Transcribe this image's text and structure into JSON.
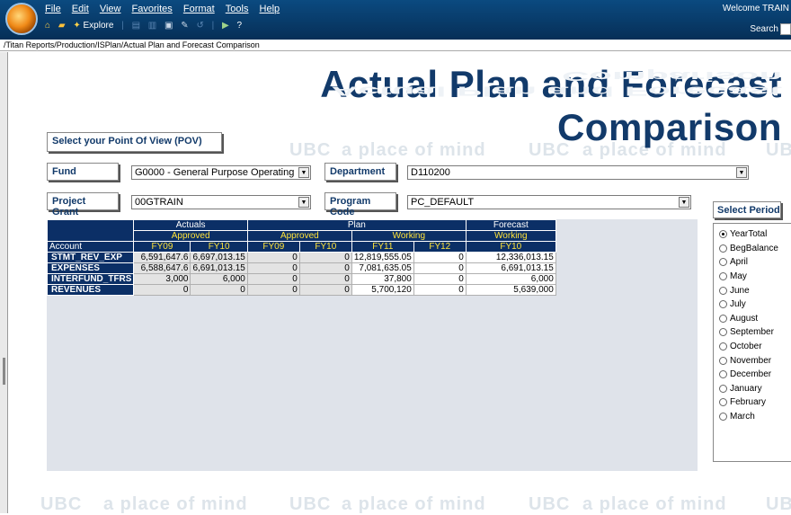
{
  "menu": [
    "File",
    "Edit",
    "View",
    "Favorites",
    "Format",
    "Tools",
    "Help"
  ],
  "toolbar": {
    "explore_label": "Explore"
  },
  "welcome": "Welcome TRAIN",
  "search_label": "Search",
  "breadcrumb": "/Titan Reports/Production/ISPlan/Actual Plan and Forecast Comparison",
  "watermark": "a place of mind",
  "watermark_logo": "UBC",
  "title": "Actual Plan and Forecast Comparison",
  "pov": {
    "header": "Select your Point Of View (POV)",
    "fund_label": "Fund",
    "fund_value": "G0000 - General Purpose Operating",
    "department_label": "Department",
    "department_value": "D110200",
    "project_label": "Project Grant",
    "project_value": "00GTRAIN",
    "program_label": "Program Code",
    "program_value": "PC_DEFAULT"
  },
  "grid": {
    "groups": [
      "Actuals",
      "Plan",
      "Forecast"
    ],
    "subgroups": [
      "Approved",
      "Approved",
      "Working",
      "Working"
    ],
    "row_header": "Account",
    "columns": [
      "FY09",
      "FY10",
      "FY09",
      "FY10",
      "FY11",
      "FY12",
      "FY10"
    ],
    "rows": [
      {
        "account": "STMT_REV_EXP",
        "values": [
          "6,591,647.6",
          "6,697,013.15",
          "0",
          "0",
          "12,819,555.05",
          "0",
          "12,336,013.15"
        ]
      },
      {
        "account": "EXPENSES",
        "values": [
          "6,588,647.6",
          "6,691,013.15",
          "0",
          "0",
          "7,081,635.05",
          "0",
          "6,691,013.15"
        ]
      },
      {
        "account": "INTERFUND_TFRS",
        "values": [
          "3,000",
          "6,000",
          "0",
          "0",
          "37,800",
          "0",
          "6,000"
        ]
      },
      {
        "account": "REVENUES",
        "values": [
          "0",
          "0",
          "0",
          "0",
          "5,700,120",
          "0",
          "5,639,000"
        ]
      }
    ]
  },
  "period": {
    "title": "Select Period",
    "selected": "YearTotal",
    "options": [
      "YearTotal",
      "BegBalance",
      "April",
      "May",
      "June",
      "July",
      "August",
      "September",
      "October",
      "November",
      "December",
      "January",
      "February",
      "March"
    ]
  }
}
